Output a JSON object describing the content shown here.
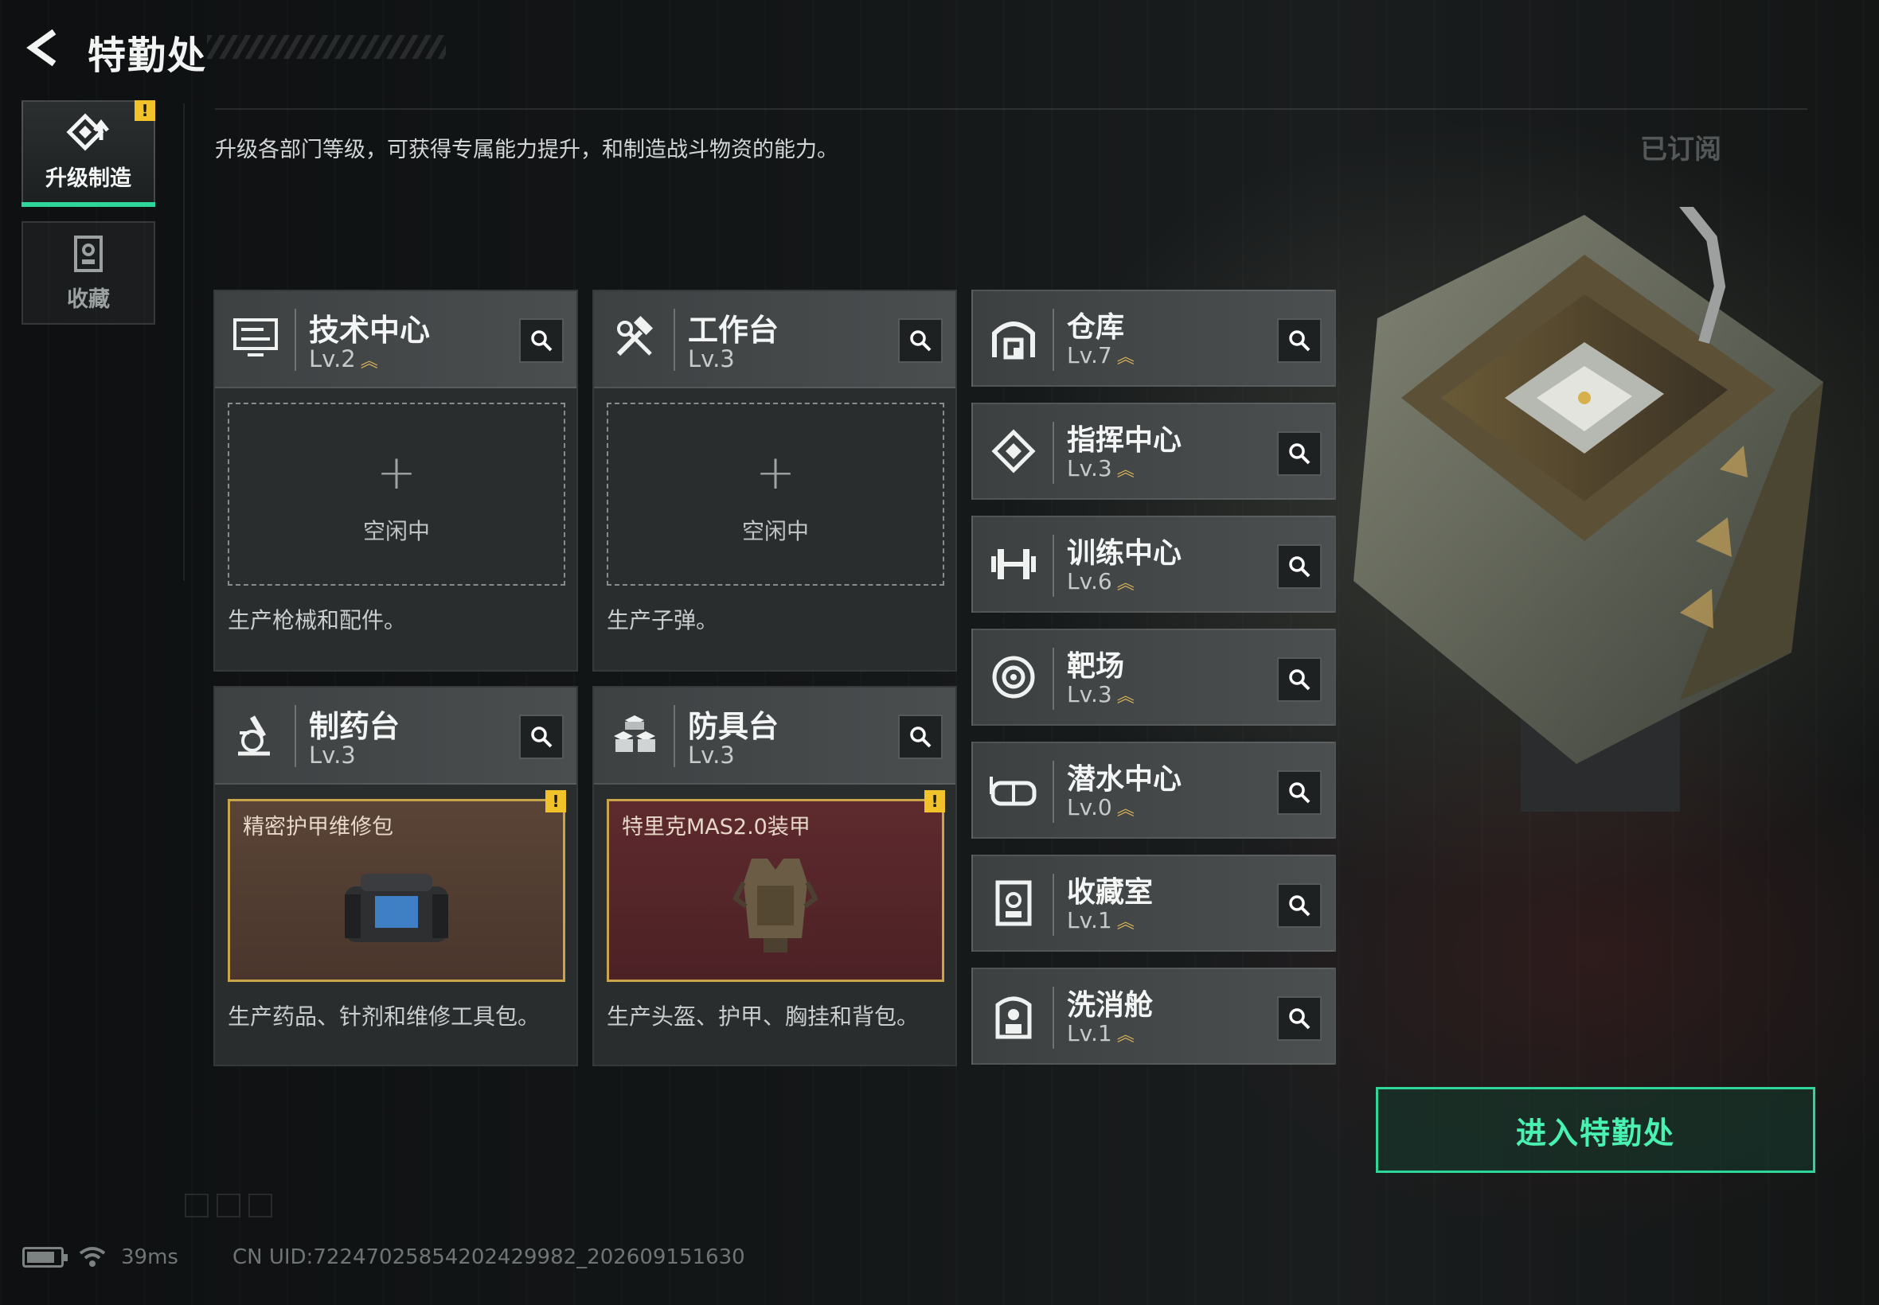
{
  "header": {
    "title": "特勤处",
    "subtitle": "升级各部门等级，可获得专属能力提升，和制造战斗物资的能力。",
    "subscribed_label": "已订阅"
  },
  "sidebar": {
    "tabs": [
      {
        "label": "升级制造",
        "icon": "upgrade-diamond-icon",
        "active": true,
        "badge": "!"
      },
      {
        "label": "收藏",
        "icon": "collection-icon",
        "active": false
      }
    ]
  },
  "production": [
    {
      "name": "技术中心",
      "level": "Lv.2",
      "upgradable": true,
      "icon": "monitor-icon",
      "slot": {
        "state": "idle",
        "plus": "+",
        "label": "空闲中"
      },
      "desc": "生产枪械和配件。"
    },
    {
      "name": "工作台",
      "level": "Lv.3",
      "upgradable": false,
      "icon": "hammer-wrench-icon",
      "slot": {
        "state": "idle",
        "plus": "+",
        "label": "空闲中"
      },
      "desc": "生产子弹。"
    },
    {
      "name": "制药台",
      "level": "Lv.3",
      "upgradable": false,
      "icon": "microscope-icon",
      "slot": {
        "state": "item",
        "item_name": "精密护甲维修包",
        "badge": "!"
      },
      "desc": "生产药品、针剂和维修工具包。"
    },
    {
      "name": "防具台",
      "level": "Lv.3",
      "upgradable": false,
      "icon": "armor-boxes-icon",
      "slot": {
        "state": "item",
        "item_name": "特里克MAS2.0装甲",
        "badge": "!"
      },
      "desc": "生产头盔、护甲、胸挂和背包。"
    }
  ],
  "facilities": [
    {
      "name": "仓库",
      "level": "Lv.7",
      "upgradable": true,
      "icon": "warehouse-icon"
    },
    {
      "name": "指挥中心",
      "level": "Lv.3",
      "upgradable": true,
      "icon": "command-diamond-icon"
    },
    {
      "name": "训练中心",
      "level": "Lv.6",
      "upgradable": true,
      "icon": "dumbbell-icon"
    },
    {
      "name": "靶场",
      "level": "Lv.3",
      "upgradable": true,
      "icon": "target-icon"
    },
    {
      "name": "潜水中心",
      "level": "Lv.0",
      "upgradable": true,
      "icon": "diving-goggles-icon"
    },
    {
      "name": "收藏室",
      "level": "Lv.1",
      "upgradable": true,
      "icon": "collection-room-icon"
    },
    {
      "name": "洗消舱",
      "level": "Lv.1",
      "upgradable": true,
      "icon": "decontamination-icon"
    }
  ],
  "actions": {
    "enter_label": "进入特勤处"
  },
  "footer": {
    "ping": "39ms",
    "uid": "CN UID:7224702585420242998​2_202609151630"
  },
  "colors": {
    "accent": "#2ed69a",
    "upgrade": "#d9b35a",
    "warning": "#f2c22a"
  }
}
